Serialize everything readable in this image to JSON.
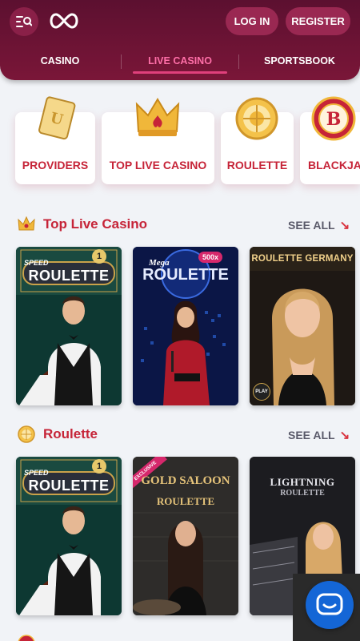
{
  "header": {
    "login_label": "LOG IN",
    "register_label": "REGISTER"
  },
  "tabs": [
    {
      "label": "CASINO",
      "active": false
    },
    {
      "label": "LIVE CASINO",
      "active": true
    },
    {
      "label": "SPORTSBOOK",
      "active": false
    }
  ],
  "categories": [
    {
      "label": "PROVIDERS",
      "icon": "providers-card-icon"
    },
    {
      "label": "TOP LIVE CASINO",
      "icon": "crown-icon"
    },
    {
      "label": "ROULETTE",
      "icon": "roulette-wheel-icon"
    },
    {
      "label": "BLACKJAC",
      "icon": "blackjack-chip-icon"
    }
  ],
  "sections": [
    {
      "title": "Top Live Casino",
      "see_all": "SEE ALL",
      "games": [
        {
          "line1": "SPEED",
          "line2": "ROULETTE",
          "badge": "1"
        },
        {
          "line1": "Mega",
          "line2": "ROULETTE",
          "badge": "500x"
        },
        {
          "line1": "ROULETTE GERMANY",
          "line2": "",
          "badge": "PLAY"
        }
      ]
    },
    {
      "title": "Roulette",
      "see_all": "SEE ALL",
      "games": [
        {
          "line1": "SPEED",
          "line2": "ROULETTE",
          "badge": "1"
        },
        {
          "line1": "GOLD SALOON",
          "line2": "ROULETTE",
          "badge": "EXCLUSIVE"
        },
        {
          "line1": "LIGHTNING",
          "line2": "ROULETTE",
          "badge": ""
        }
      ]
    }
  ],
  "colors": {
    "brand": "#7a1638",
    "accent": "#c62438",
    "chat": "#1466d6"
  }
}
